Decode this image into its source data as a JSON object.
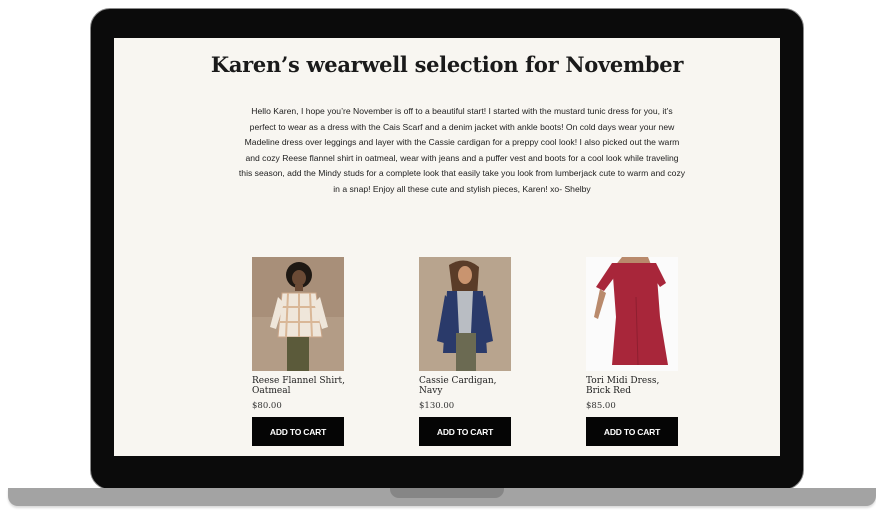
{
  "page": {
    "title": "Karen’s wearwell selection for November",
    "intro": "Hello Karen, I hope you’re November is off to a beautiful start! I started with the mustard tunic dress for you, it’s perfect to wear as a dress with the Cais Scarf and a denim jacket with ankle boots! On cold days wear your new Madeline dress over leggings and layer with the Cassie cardigan for a preppy cool look! I also picked out the warm and cozy Reese flannel shirt in oatmeal, wear with jeans and a puffer vest and boots for a cool look while traveling this season, add the Mindy studs for a complete look that easily take you look from lumberjack cute to warm and cozy in a snap! Enjoy all these cute and stylish pieces, Karen! xo- Shelby"
  },
  "products": [
    {
      "name": "Reese Flannel Shirt, Oatmeal",
      "price": "$80.00",
      "button": "ADD TO CART",
      "image": "model-in-plaid-flannel-shirt"
    },
    {
      "name": "Cassie Cardigan, Navy",
      "price": "$130.00",
      "button": "ADD TO CART",
      "image": "model-in-navy-cardigan"
    },
    {
      "name": "Tori Midi Dress, Brick Red",
      "price": "$85.00",
      "button": "ADD TO CART",
      "image": "model-in-red-midi-dress"
    }
  ],
  "colors": {
    "screen_background": "#f8f6f1",
    "button_background": "#050505",
    "button_text": "#ffffff",
    "dress_red": "#a8263a",
    "cardigan_navy": "#2a3a6a"
  }
}
